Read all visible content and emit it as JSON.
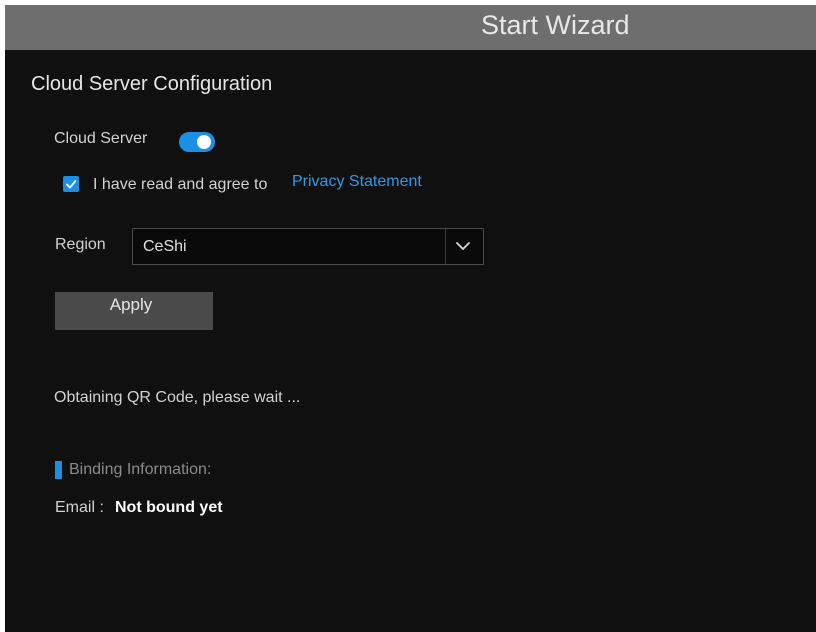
{
  "window": {
    "title": "Start Wizard"
  },
  "page": {
    "heading": "Cloud Server Configuration"
  },
  "cloud_server": {
    "label": "Cloud Server",
    "enabled": true
  },
  "agreement": {
    "checked": true,
    "text": "I have read and agree to",
    "link_text": "Privacy Statement"
  },
  "region": {
    "label": "Region",
    "selected": "CeShi"
  },
  "actions": {
    "apply_label": "Apply"
  },
  "status": {
    "message": "Obtaining QR Code, please wait ..."
  },
  "binding": {
    "section_title": "Binding Information:",
    "email_label": "Email :",
    "email_value": "Not bound yet"
  },
  "colors": {
    "accent": "#1a8fe3",
    "link": "#2a9be8",
    "background": "#101010",
    "titlebar": "#6e6e6e",
    "button": "#4a4a4a"
  },
  "icons": {
    "toggle": "toggle-switch-icon",
    "checkbox": "checkmark-icon",
    "dropdown": "chevron-down-icon"
  }
}
